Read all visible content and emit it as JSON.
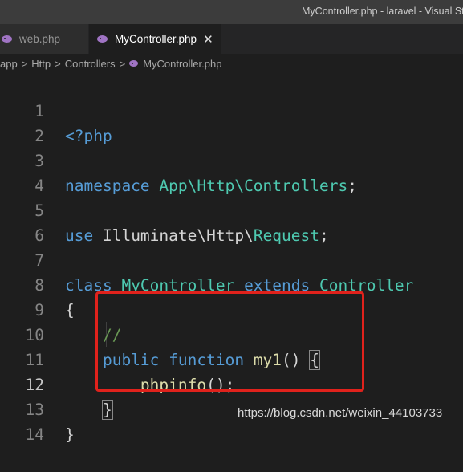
{
  "window": {
    "title": "MyController.php - laravel - Visual St"
  },
  "tabs": [
    {
      "label": "web.php",
      "icon": "php-icon"
    },
    {
      "label": "MyController.php",
      "icon": "php-icon",
      "close": "✕"
    }
  ],
  "breadcrumb": {
    "items": [
      "app",
      "Http",
      "Controllers",
      "MyController.php"
    ],
    "separator": ">"
  },
  "editor": {
    "line_numbers": [
      "1",
      "2",
      "3",
      "4",
      "5",
      "6",
      "7",
      "8",
      "9",
      "10",
      "11",
      "12",
      "13",
      "14"
    ],
    "current_line": "12",
    "lines": {
      "l1": {
        "t1": "<?php"
      },
      "l3": {
        "t1": "namespace",
        "t2": " App\\Http\\Controllers",
        "t3": ";"
      },
      "l5": {
        "t1": "use",
        "t2": " Illuminate\\Http\\",
        "t3": "Request",
        "t4": ";"
      },
      "l7": {
        "t1": "class",
        "t2": " MyController",
        "t3": " extends",
        "t4": " Controller"
      },
      "l8": {
        "t1": "{"
      },
      "l9": {
        "t1": "    //"
      },
      "l10": {
        "t1": "    public",
        "t2": " function",
        "t3": " my1",
        "t4": "() ",
        "t5": "{"
      },
      "l11": {
        "t1": "        phpinfo",
        "t2": "();"
      },
      "l12": {
        "t1": "    ",
        "t2": "}"
      },
      "l13": {
        "t1": "}"
      }
    },
    "colors": {
      "keyword": "#569cd6",
      "type": "#4ec9b0",
      "function": "#dcdcaa",
      "comment": "#6a9955",
      "text": "#d4d4d4",
      "annotation_box": "#e0221c"
    }
  },
  "watermark": "https://blog.csdn.net/weixin_44103733"
}
